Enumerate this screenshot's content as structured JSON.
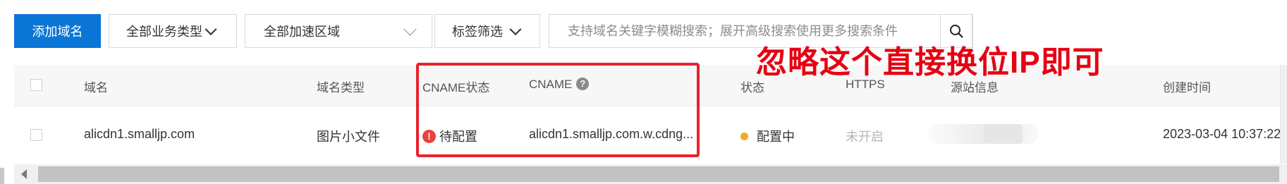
{
  "toolbar": {
    "add_domain_label": "添加域名",
    "business_type_select": "全部业务类型",
    "region_select": "全部加速区域",
    "tag_filter": "标签筛选",
    "search_placeholder": "支持域名关键字模糊搜索；展开高级搜索使用更多搜索条件"
  },
  "annotation": {
    "text": "忽略这个直接换位IP即可",
    "color": "#e60012"
  },
  "table": {
    "headers": {
      "domain": "域名",
      "domain_type": "域名类型",
      "cname_status": "CNAME状态",
      "cname": "CNAME",
      "status": "状态",
      "https": "HTTPS",
      "origin_info": "源站信息",
      "created_time": "创建时间"
    },
    "rows": [
      {
        "domain": "alicdn1.smalljp.com",
        "domain_type": "图片小文件",
        "cname_status": "待配置",
        "cname": "alicdn1.smalljp.com.w.cdng...",
        "status": "配置中",
        "https": "未开启",
        "created_time": "2023-03-04 10:37:22"
      }
    ]
  },
  "colors": {
    "primary": "#0b76d6",
    "warning": "#e8443a",
    "status_dot": "#f5a623",
    "highlight_box": "#e8222c"
  },
  "icons": [
    "chevron-down-icon",
    "search-icon",
    "help-icon",
    "warning-icon",
    "status-dot-icon",
    "scroll-left-icon"
  ]
}
